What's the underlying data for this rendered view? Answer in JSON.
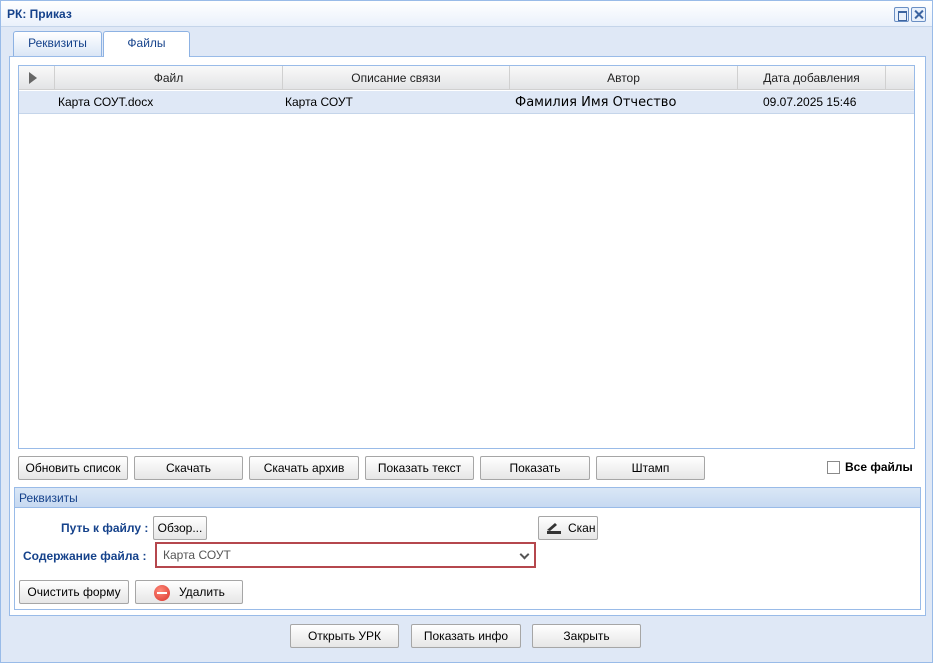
{
  "window": {
    "title": "РК: Приказ"
  },
  "tabs": [
    {
      "label": "Реквизиты"
    },
    {
      "label": "Файлы"
    }
  ],
  "grid": {
    "columns": [
      "Файл",
      "Описание связи",
      "Автор",
      "Дата добавления"
    ],
    "rows": [
      {
        "file": "Карта СОУТ.docx",
        "description": "Карта СОУТ",
        "author": "Фамилия Имя Отчество",
        "date": "09.07.2025 15:46"
      }
    ]
  },
  "toolbar": {
    "refresh": "Обновить список",
    "download": "Скачать",
    "download_archive": "Скачать архив",
    "show_text": "Показать текст",
    "show": "Показать",
    "stamp": "Штамп",
    "all_files": "Все файлы"
  },
  "requisites": {
    "title": "Реквизиты",
    "file_path_label": "Путь к файлу :",
    "browse": "Обзор...",
    "scan": "Скан",
    "content_label": "Содержание файла :",
    "content_value": "Карта СОУТ",
    "clear_form": "Очистить форму",
    "delete": "Удалить"
  },
  "footer": {
    "open_urk": "Открыть УРК",
    "show_info": "Показать инфо",
    "close": "Закрыть"
  }
}
